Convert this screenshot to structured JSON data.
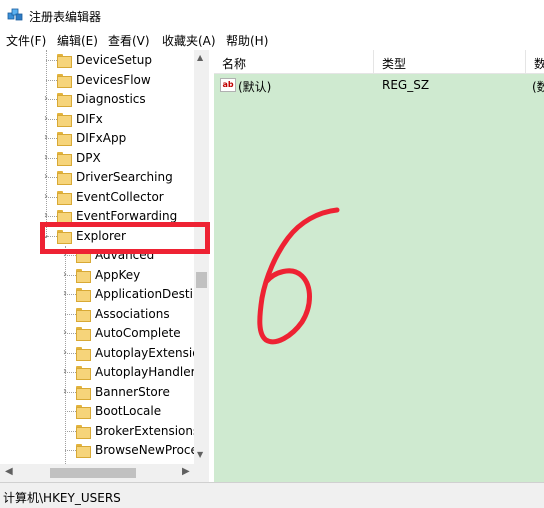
{
  "window": {
    "title": "注册表编辑器",
    "icon": "regedit-icon"
  },
  "menu": [
    {
      "label": "文件(F)"
    },
    {
      "label": "编辑(E)"
    },
    {
      "label": "查看(V)"
    },
    {
      "label": "收藏夹(A)"
    },
    {
      "label": "帮助(H)"
    }
  ],
  "tree": {
    "items": [
      {
        "label": "DeviceSetup",
        "expandable": false
      },
      {
        "label": "DevicesFlow",
        "expandable": false
      },
      {
        "label": "Diagnostics",
        "expandable": true
      },
      {
        "label": "DIFx",
        "expandable": true
      },
      {
        "label": "DIFxApp",
        "expandable": true
      },
      {
        "label": "DPX",
        "expandable": true
      },
      {
        "label": "DriverSearching",
        "expandable": true
      },
      {
        "label": "EventCollector",
        "expandable": true
      },
      {
        "label": "EventForwarding",
        "expandable": true
      },
      {
        "label": "Explorer",
        "expandable": true,
        "expanded": true,
        "selected": true
      },
      {
        "label": "Advanced",
        "expandable": true,
        "child": true
      },
      {
        "label": "AppKey",
        "expandable": true,
        "child": true
      },
      {
        "label": "ApplicationDestin",
        "expandable": true,
        "child": true
      },
      {
        "label": "Associations",
        "expandable": false,
        "child": true
      },
      {
        "label": "AutoComplete",
        "expandable": true,
        "child": true
      },
      {
        "label": "AutoplayExtensio",
        "expandable": true,
        "child": true
      },
      {
        "label": "AutoplayHandlers",
        "expandable": true,
        "child": true
      },
      {
        "label": "BannerStore",
        "expandable": true,
        "child": true
      },
      {
        "label": "BootLocale",
        "expandable": false,
        "child": true
      },
      {
        "label": "BrokerExtensions",
        "expandable": false,
        "child": true
      },
      {
        "label": "BrowseNewProce",
        "expandable": false,
        "child": true
      }
    ]
  },
  "values": {
    "columns": [
      {
        "label": "名称"
      },
      {
        "label": "类型"
      },
      {
        "label": "数"
      }
    ],
    "rows": [
      {
        "name": "(默认)",
        "type": "REG_SZ",
        "data": "(数",
        "icon": "string-value-icon"
      }
    ]
  },
  "status": {
    "path": "计算机\\HKEY_USERS"
  },
  "annotation": {
    "highlight_color": "#ee2233",
    "stroke_color": "#ee2233"
  }
}
